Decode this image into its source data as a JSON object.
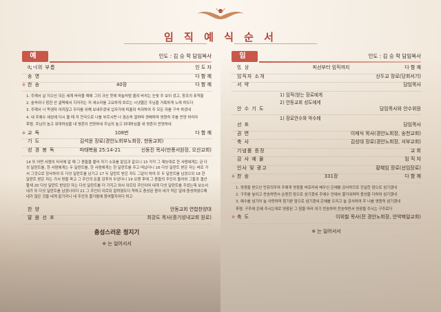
{
  "title": "임 직 예 식 순 서",
  "worship": {
    "label": "예 배",
    "preacher": "인도 : 김 승 학 담임목사",
    "rows_top": [
      {
        "label": "예배의 부름",
        "content": "",
        "right": "인  도  자",
        "mark": ""
      },
      {
        "label": "송        영",
        "content": "",
        "right": "다 함 께",
        "mark": ""
      },
      {
        "label": "찬        송",
        "content": "40장",
        "right": "다 함 께",
        "mark": "※"
      }
    ],
    "confession": [
      "1. 주께서 날 지으신 모든 세계 바라볼 때에 그의 크신 뜻에 하늘처럼 올려 바치는 눈빛 주 보이 셨고, 창조의 표적들",
      "2. 숲속이나 험한 산 골짝에서 지저귀는 저 새소리를 고요하게 흐르는 시냇물은 주님을 거룩하게 노래 하도다",
      "3. 주께서 나 독생자 아끼잖고 우리를 위해 보내주셨네 십자가에 피흘려 속죄하여 주 모든 죄를 구속 하셨네",
      "4. 내 주예수 세상에 다시 올 때 저 천국으로 나를 부르시면 나 겸손히 절하며 경배하며 영원히 주를 찬양 하리라",
      "후렴. 주님의 높고 위대하심을 내 영혼이 찬양하네 주님의 높고 위대하심을 내 영혼이 찬양하네"
    ],
    "rows_mid": [
      {
        "label": "교        독",
        "content": "108번",
        "right": "다 함 께",
        "mark": "※"
      },
      {
        "label": "기        도",
        "content": "김석윤 장로(경안노회부노회장, 현동교회)",
        "right": "",
        "mark": ""
      },
      {
        "label": "성 경 봉 독",
        "content": "마태복음 25:14-21",
        "right": "신동진 목사(만풍서원장, 오산교회)",
        "mark": ""
      }
    ],
    "scripture": "14 또 어떤 사람이 타국에 갈 때 그 종들을 불러 자기 소유를 맡김과 같으니 15 각각 그 재능대로 한 사람에게는 금 다섯 달란트를, 한 사람에게는 두 달란트를, 한 사람에게는 한 달란트를 주고 떠났더니 16 다섯 달란트 받은 자는 바로 가서 그것으로 장사하여 또 다섯 달란트를 남기고 17 두 달란트 받은 자도 그같이 하여 또 두 달란트를 남겼으되 18 한 달란트 받은 자는 가서 땅을 파고 그 주인의 돈을 감추어 두었더니 19 오랜 후에 그 종들의 주인이 돌아와 그들과 결산할새 20 다섯 달란트 받았던 자는 다섯 달란트를 더 가지고 와서 이르되 주인이여 내게 다섯 달란트를 주셨는데 보소서 내가 또 다섯 달란트를 남겼나이다 21 그 주인이 이르되 잘하였도다 착하고 충성된 종아 네가 적은 일에 충성하였으매 내가 많은 것을 네게 맡기리니 네 주인의 즐거움에 참여할지어다 하고",
    "rows_bottom": [
      {
        "label": "찬        양",
        "content": "",
        "right": "안동교회 연합찬양대",
        "mark": ""
      },
      {
        "label": "말 씀 선 포",
        "content": "",
        "right": "최강도 목사(증기성내교회 원로)",
        "mark": ""
      }
    ],
    "sermon_title": "충성스러운 청지기",
    "standing_note": "※ 는 일어서서"
  },
  "ordination": {
    "label": "임 직",
    "preacher": "인도 : 김 승 학 담임목사",
    "rows_a": [
      {
        "label": "영        상",
        "content": "피선부터 임직까지",
        "right": "다 함 께",
        "mark": ""
      },
      {
        "label": "임직자 소개",
        "content": "",
        "right": "신두교 장로(당회서기)",
        "mark": ""
      },
      {
        "label": "서        약",
        "content": "",
        "right": "담임목사",
        "mark": ""
      }
    ],
    "vows_1": [
      "1) 임직(받는 장로에게",
      "2) 안동교회 성도에게"
    ],
    "rows_b": [
      {
        "label": "안 수 기 도",
        "content": "",
        "right": "담임목사와 안수위원",
        "mark": ""
      }
    ],
    "vows_2": [
      "1) 장로안수와 악수례"
    ],
    "rows_c": [
      {
        "label": "선        포",
        "content": "",
        "right": "담임목사",
        "mark": ""
      },
      {
        "label": "권        면",
        "content": "",
        "right": "이제식 목사(경안노회장, 송천교회)",
        "mark": ""
      },
      {
        "label": "축        사",
        "content": "",
        "right": "김성대 장로(경안노회장, 서부교회)",
        "mark": ""
      },
      {
        "label": "기념품 증정",
        "content": "",
        "right": "교  회",
        "mark": ""
      },
      {
        "label": "감 사 예 물",
        "content": "",
        "right": "임  직  자",
        "mark": ""
      },
      {
        "label": "인사 및 광고",
        "content": "",
        "right": "황혜임 장로(선임장로)",
        "mark": ""
      },
      {
        "label": "찬        송",
        "content": "331장",
        "right": "다 함 께",
        "mark": "※"
      }
    ],
    "hymn": [
      "1. 영광을 받으신 만유의주여 주에게 영광을 바로라내 배우신 은혜를 감사하므로 진실한 맘으로 섬기겠네",
      "2. 구주를 높이고 찬송하면서 순종한 맘으로 섬기겠네 주예수 안에서 즐거워하며 충성을 다하여 섬기겠네",
      "3. 예수를 넘기어 늘 사랑하며 참기쁜 맘으로 섬기겠네 은혜를 도리고 늘 감사하여 주 나를 영원히 섬기겠네",
      "후렴. 구주에 은혜 주시는대로 영광된 그 맘을 따라 여기 찬송하며 찬송하면서 영광을 주시는 구주로다"
    ],
    "rows_d": [
      {
        "label": "축        도",
        "content": "",
        "right": "이위철 목사(전 경안노회장, 안약제일교회)",
        "mark": "※"
      }
    ],
    "standing_note": "※ 는 일어서서"
  }
}
